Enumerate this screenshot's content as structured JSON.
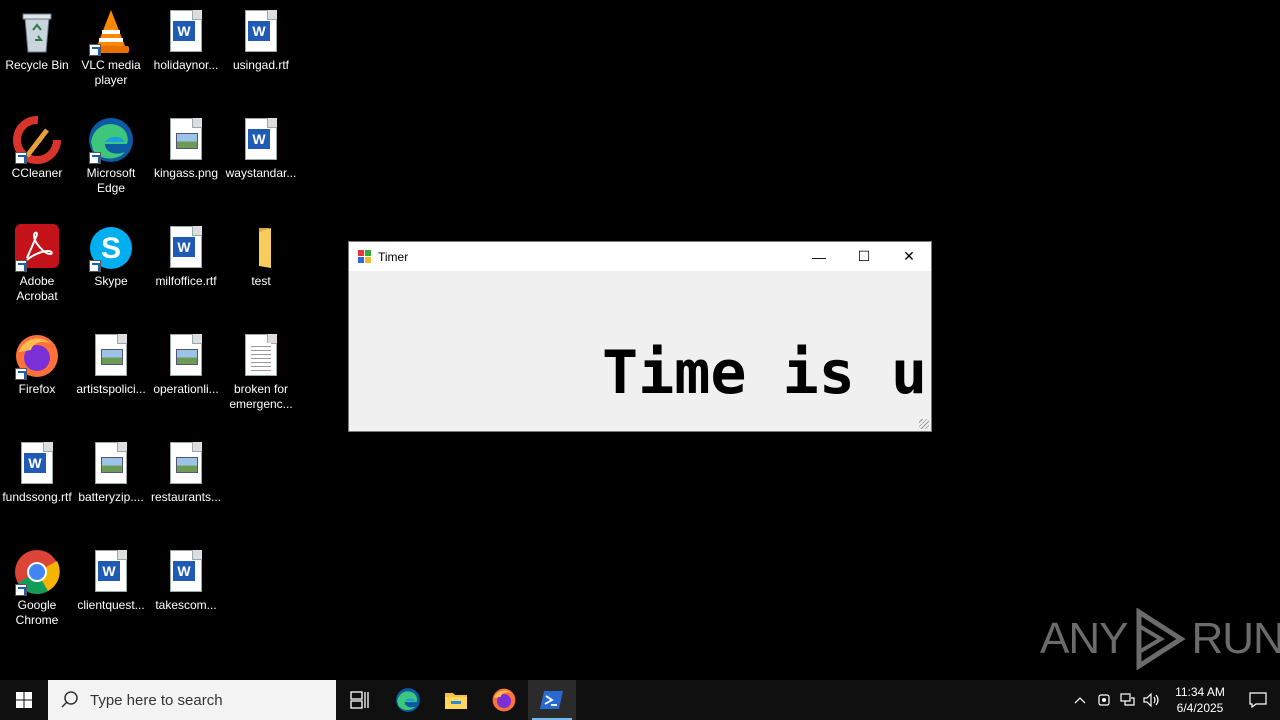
{
  "desktop": {
    "icons": [
      {
        "label": "Recycle Bin",
        "icon": "recycle-bin-icon"
      },
      {
        "label": "VLC media player",
        "icon": "vlc-icon"
      },
      {
        "label": "holidaynor...",
        "icon": "word-doc-icon"
      },
      {
        "label": "usingad.rtf",
        "icon": "word-doc-icon"
      },
      {
        "label": "CCleaner",
        "icon": "ccleaner-icon"
      },
      {
        "label": "Microsoft Edge",
        "icon": "edge-icon"
      },
      {
        "label": "kingass.png",
        "icon": "image-file-icon"
      },
      {
        "label": "waystandar...",
        "icon": "word-doc-icon"
      },
      {
        "label": "Adobe Acrobat",
        "icon": "acrobat-icon"
      },
      {
        "label": "Skype",
        "icon": "skype-icon"
      },
      {
        "label": "milfoffice.rtf",
        "icon": "word-doc-icon"
      },
      {
        "label": "test",
        "icon": "folder-icon"
      },
      {
        "label": "Firefox",
        "icon": "firefox-icon"
      },
      {
        "label": "artistspolici...",
        "icon": "image-file-icon"
      },
      {
        "label": "operationli...",
        "icon": "image-file-icon"
      },
      {
        "label": "broken for emergenc...",
        "icon": "text-file-icon"
      },
      {
        "label": "fundssong.rtf",
        "icon": "word-doc-icon"
      },
      {
        "label": "batteryzip....",
        "icon": "image-file-icon"
      },
      {
        "label": "restaurants...",
        "icon": "image-file-icon"
      },
      {
        "label": "Google Chrome",
        "icon": "chrome-icon"
      },
      {
        "label": "clientquest...",
        "icon": "word-doc-icon"
      },
      {
        "label": "takescom...",
        "icon": "word-doc-icon"
      }
    ]
  },
  "window": {
    "title": "Timer",
    "message": "Time is up",
    "minimize_glyph": "—",
    "maximize_glyph": "☐",
    "close_glyph": "✕"
  },
  "watermark": {
    "left": "ANY",
    "right": "RUN"
  },
  "taskbar": {
    "search_placeholder": "Type here to search",
    "clock_time": "11:34 AM",
    "clock_date": "6/4/2025",
    "apps": [
      "task-view-icon",
      "edge-icon",
      "file-explorer-icon",
      "firefox-icon",
      "powershell-icon"
    ]
  }
}
